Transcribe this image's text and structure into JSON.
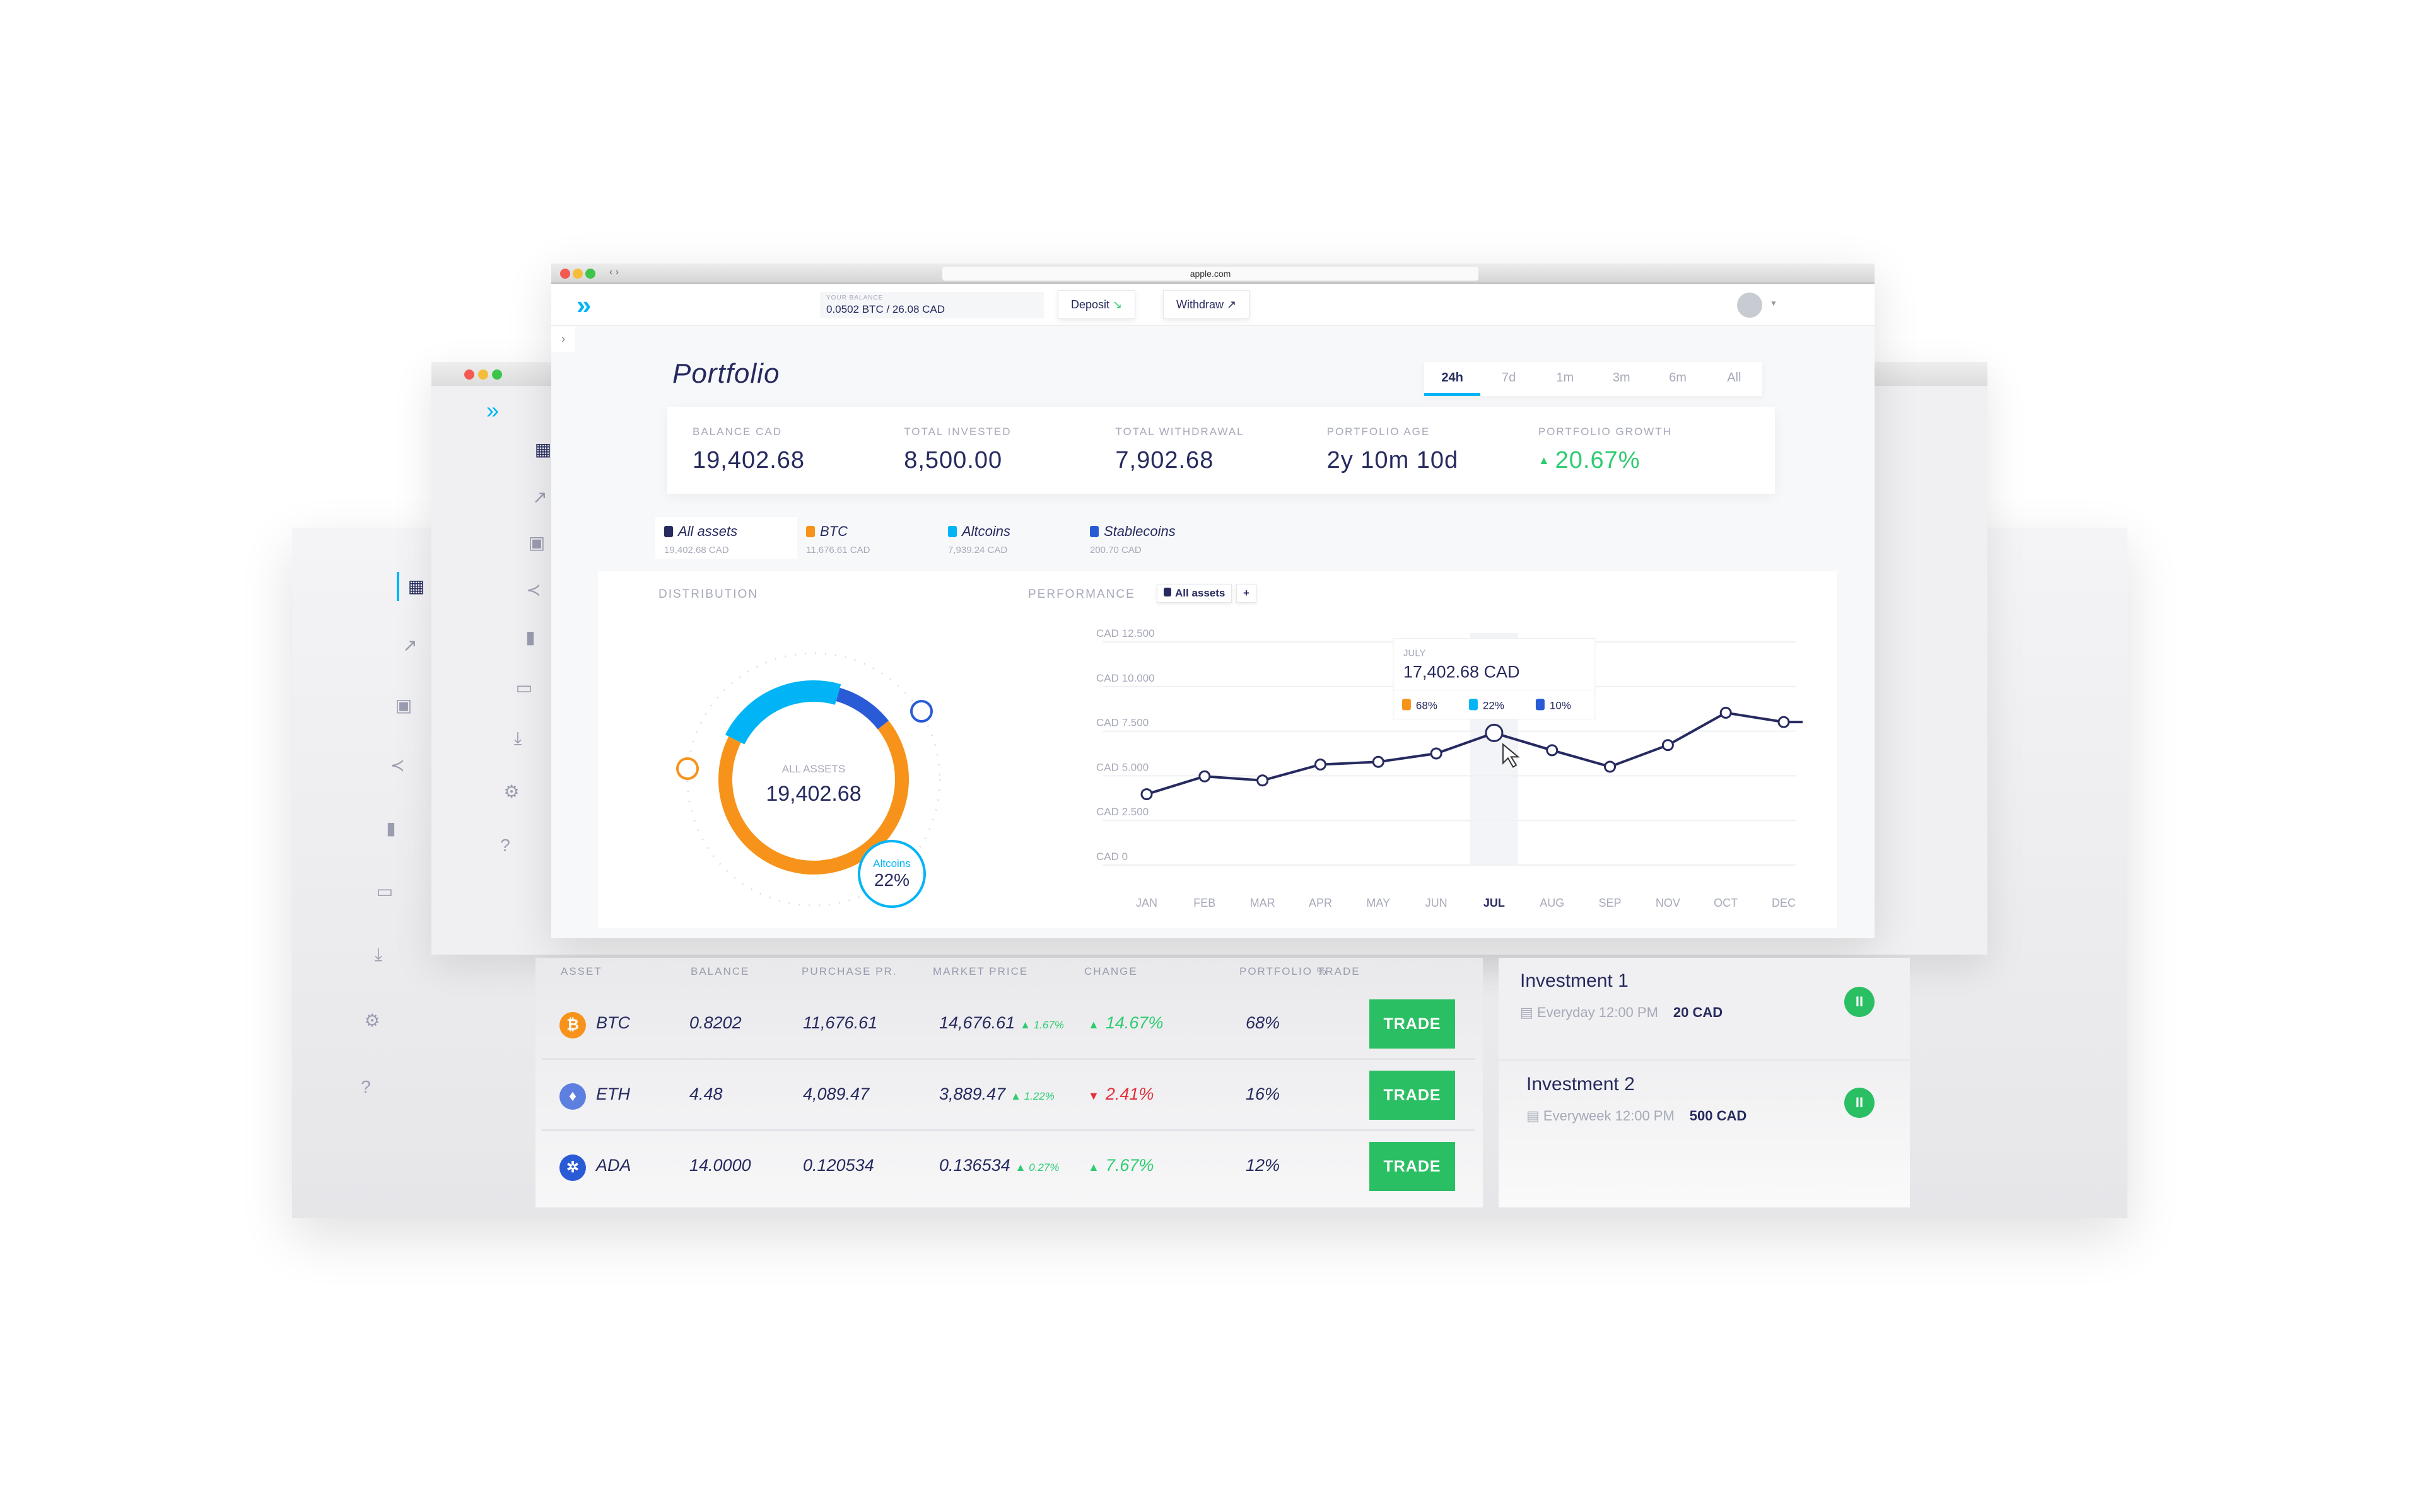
{
  "browser": {
    "url": "apple.com"
  },
  "header": {
    "balance_label": "YOUR BALANCE",
    "balance_value": "0.0502 BTC / 26.08 CAD",
    "deposit": "Deposit",
    "withdraw": "Withdraw"
  },
  "page": {
    "title": "Portfolio"
  },
  "time_tabs": [
    {
      "label": "24h",
      "active": true
    },
    {
      "label": "7d"
    },
    {
      "label": "1m"
    },
    {
      "label": "3m"
    },
    {
      "label": "6m"
    },
    {
      "label": "All"
    }
  ],
  "stats": [
    {
      "label": "BALANCE CAD",
      "value": "19,402.68"
    },
    {
      "label": "TOTAL INVESTED",
      "value": "8,500.00"
    },
    {
      "label": "TOTAL WITHDRAWAL",
      "value": "7,902.68"
    },
    {
      "label": "PORTFOLIO AGE",
      "value": "2y 10m 10d"
    },
    {
      "label": "PORTFOLIO GROWTH",
      "value": "20.67%",
      "trend": "up"
    }
  ],
  "asset_tabs": [
    {
      "label": "All assets",
      "sub": "19,402.68 CAD",
      "color": "#262a5e",
      "active": true
    },
    {
      "label": "BTC",
      "sub": "11,676.61 CAD",
      "color": "#f7931a"
    },
    {
      "label": "Altcoins",
      "sub": "7,939.24 CAD",
      "color": "#00b4f5"
    },
    {
      "label": "Stablecoins",
      "sub": "200.70 CAD",
      "color": "#2a5bd7"
    }
  ],
  "distribution": {
    "label": "DISTRIBUTION",
    "center_label": "ALL ASSETS",
    "center_value": "19,402.68",
    "callout_label": "Altcoins",
    "callout_value": "22%",
    "segments": [
      {
        "name": "BTC",
        "percent": 68,
        "color": "#f7931a"
      },
      {
        "name": "Altcoins",
        "percent": 22,
        "color": "#00b4f5"
      },
      {
        "name": "Stablecoins",
        "percent": 10,
        "color": "#2a5bd7"
      }
    ]
  },
  "performance": {
    "label": "PERFORMANCE",
    "filter": "All assets",
    "add": "+"
  },
  "chart_data": {
    "type": "line",
    "categories": [
      "JAN",
      "FEB",
      "MAR",
      "APR",
      "MAY",
      "JUN",
      "JUL",
      "AUG",
      "SEP",
      "NOV",
      "OCT",
      "DEC"
    ],
    "values": [
      3970,
      4970,
      4740,
      5630,
      5780,
      6250,
      7400,
      6430,
      5510,
      6720,
      8530,
      8010
    ],
    "yticks": [
      "CAD 0",
      "CAD 2.500",
      "CAD 5.000",
      "CAD 7.500",
      "CAD 10.000",
      "CAD 12.500"
    ],
    "ylim": [
      0,
      12500
    ],
    "highlight": "JUL",
    "color": "#262a5e",
    "tooltip": {
      "month": "JULY",
      "value": "17,402.68 CAD",
      "breakdown": [
        {
          "value": "68%",
          "color": "#f7931a"
        },
        {
          "value": "22%",
          "color": "#00b4f5"
        },
        {
          "value": "10%",
          "color": "#2a5bd7"
        }
      ]
    }
  },
  "table": {
    "headers": [
      "ASSET",
      "BALANCE",
      "PURCHASE PR.",
      "MARKET PRICE",
      "CHANGE",
      "PORTFOLIO %",
      "TRADE"
    ],
    "rows": [
      {
        "asset": "BTC",
        "icon": "bitcoin-icon",
        "color": "#f7931a",
        "balance": "0.8202",
        "purchase": "11,676.61",
        "market": "14,676.61",
        "market_change": "1.67%",
        "change": "14.67%",
        "trend": "up",
        "portfolio": "68%",
        "trade": "TRADE"
      },
      {
        "asset": "ETH",
        "icon": "ethereum-icon",
        "color": "#5c7fe0",
        "balance": "4.48",
        "purchase": "4,089.47",
        "market": "3,889.47",
        "market_change": "1.22%",
        "change": "2.41%",
        "trend": "down",
        "portfolio": "16%",
        "trade": "TRADE"
      },
      {
        "asset": "ADA",
        "icon": "cardano-icon",
        "color": "#2a5bd7",
        "balance": "14.0000",
        "purchase": "0.120534",
        "market": "0.136534",
        "market_change": "0.27%",
        "change": "7.67%",
        "trend": "up",
        "portfolio": "12%",
        "trade": "TRADE"
      }
    ]
  },
  "investments": [
    {
      "title": "Investment 1",
      "schedule": "Everyday 12:00 PM",
      "amount": "20 CAD"
    },
    {
      "title": "Investment 2",
      "schedule": "Everyweek 12:00 PM",
      "amount": "500 CAD"
    }
  ],
  "colors": {
    "navy": "#262a5e",
    "green": "#2ecc71",
    "red": "#e0323c",
    "cyan": "#00b4f5",
    "orange": "#f7931a"
  }
}
